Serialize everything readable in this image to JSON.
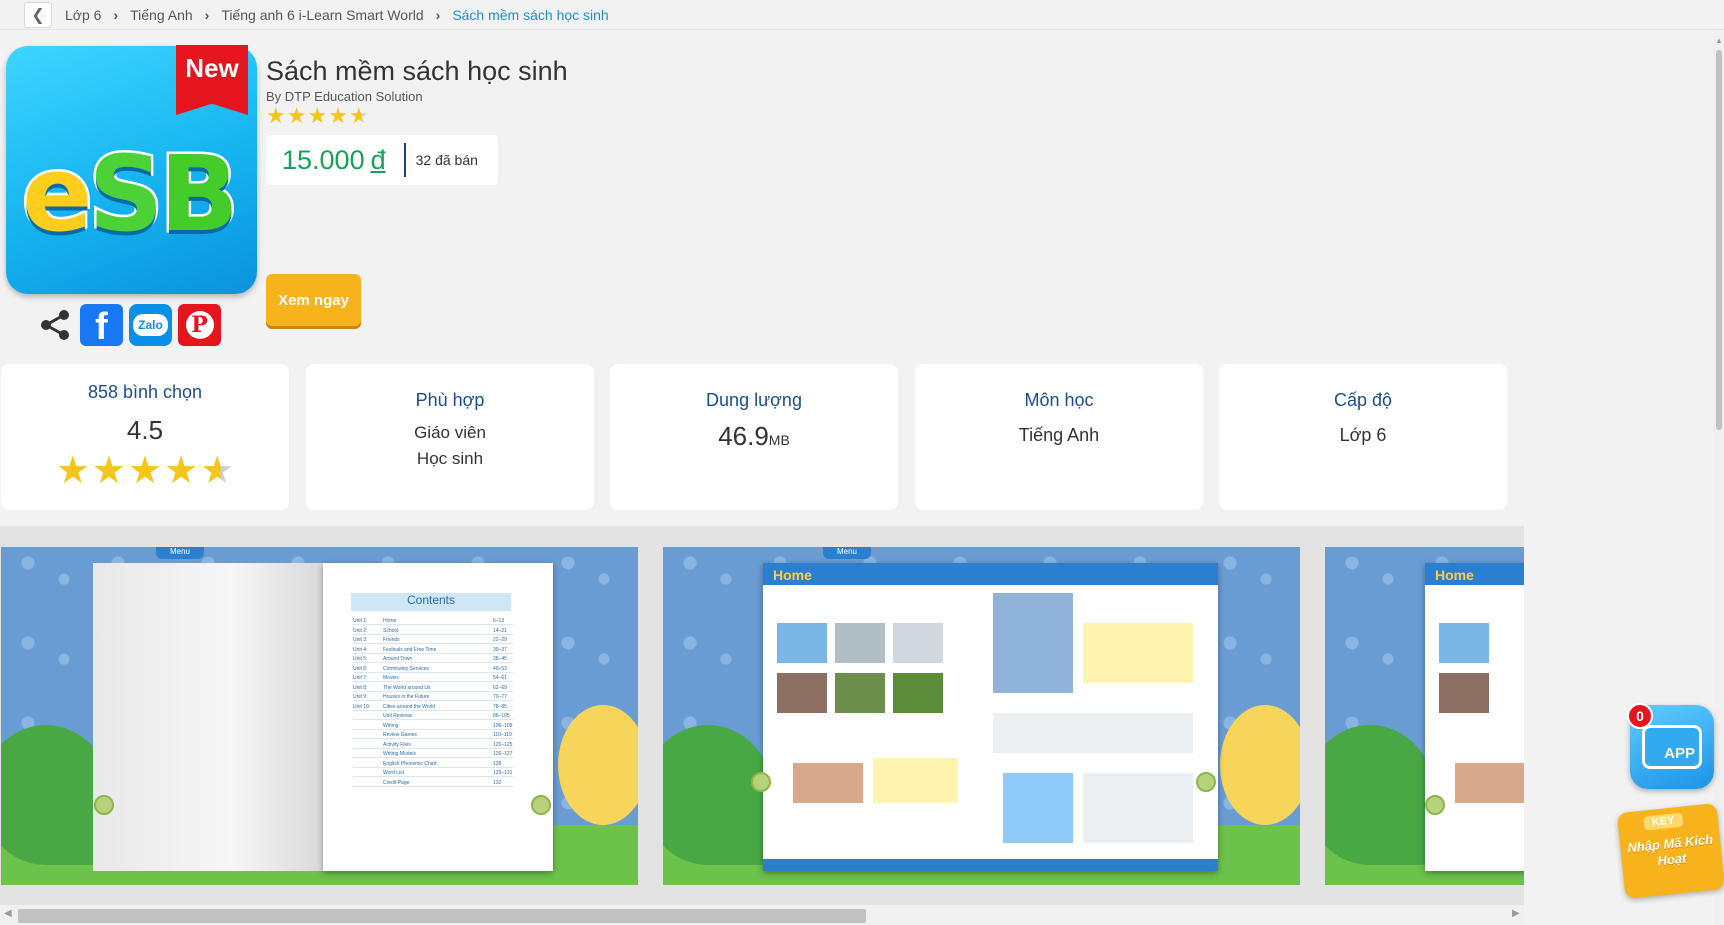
{
  "breadcrumb": {
    "back_icon": "chevron-left-icon",
    "items": [
      "Lớp 6",
      "Tiếng Anh",
      "Tiếng anh 6 i-Learn Smart World",
      "Sách mềm sách học sinh"
    ]
  },
  "product": {
    "badge": "New",
    "logo_letters": [
      "e",
      "S",
      "B"
    ],
    "title": "Sách mềm sách học sinh",
    "author": "By DTP Education Solution",
    "rating": 4.5,
    "price": "15.000",
    "currency": "đ",
    "sold": "32 đã bán",
    "view_button": "Xem ngay"
  },
  "share": {
    "icons": [
      "share-icon",
      "facebook-icon",
      "zalo-icon",
      "pinterest-icon"
    ],
    "zalo_label": "Zalo"
  },
  "stats": {
    "votes": {
      "title": "858 bình chọn",
      "value": "4.5",
      "stars": 4.5
    },
    "audience": {
      "title": "Phù hợp",
      "lines": [
        "Giáo viên",
        "Học sinh"
      ]
    },
    "size": {
      "title": "Dung lượng",
      "value": "46.9",
      "unit": "MB"
    },
    "subject": {
      "title": "Môn học",
      "value": "Tiếng Anh"
    },
    "level": {
      "title": "Cấp độ",
      "value": "Lớp 6"
    }
  },
  "previews": {
    "menu_label": "Menu",
    "contents_title": "Contents",
    "toc": [
      [
        "Unit 1:",
        "Home",
        "6–13"
      ],
      [
        "Unit 2:",
        "School",
        "14–21"
      ],
      [
        "Unit 3:",
        "Friends",
        "22–29"
      ],
      [
        "Unit 4:",
        "Festivals and Free Time",
        "30–37"
      ],
      [
        "Unit 5:",
        "Around Town",
        "38–45"
      ],
      [
        "Unit 6:",
        "Community Services",
        "46–53"
      ],
      [
        "Unit 7:",
        "Movies",
        "54–61"
      ],
      [
        "Unit 8:",
        "The World around Us",
        "62–69"
      ],
      [
        "Unit 9:",
        "Houses in the Future",
        "70–77"
      ],
      [
        "Unit 10:",
        "Cities around the World",
        "78–85"
      ],
      [
        "",
        "Unit Reviews",
        "86–105"
      ],
      [
        "",
        "Writing",
        "106–109"
      ],
      [
        "",
        "Review Games",
        "110–119"
      ],
      [
        "",
        "Activity Files",
        "120–125"
      ],
      [
        "",
        "Writing Models",
        "126–127"
      ],
      [
        "",
        "English Phonemic Chart",
        "128"
      ],
      [
        "",
        "Word List",
        "129–131"
      ],
      [
        "",
        "Credit Page",
        "132"
      ]
    ],
    "unit_page_title": "Home"
  },
  "widgets": {
    "app_badge_count": "0",
    "app_label": "APP",
    "key_tag": "KEY",
    "key_text": "Nhập Mã Kích Hoạt"
  }
}
